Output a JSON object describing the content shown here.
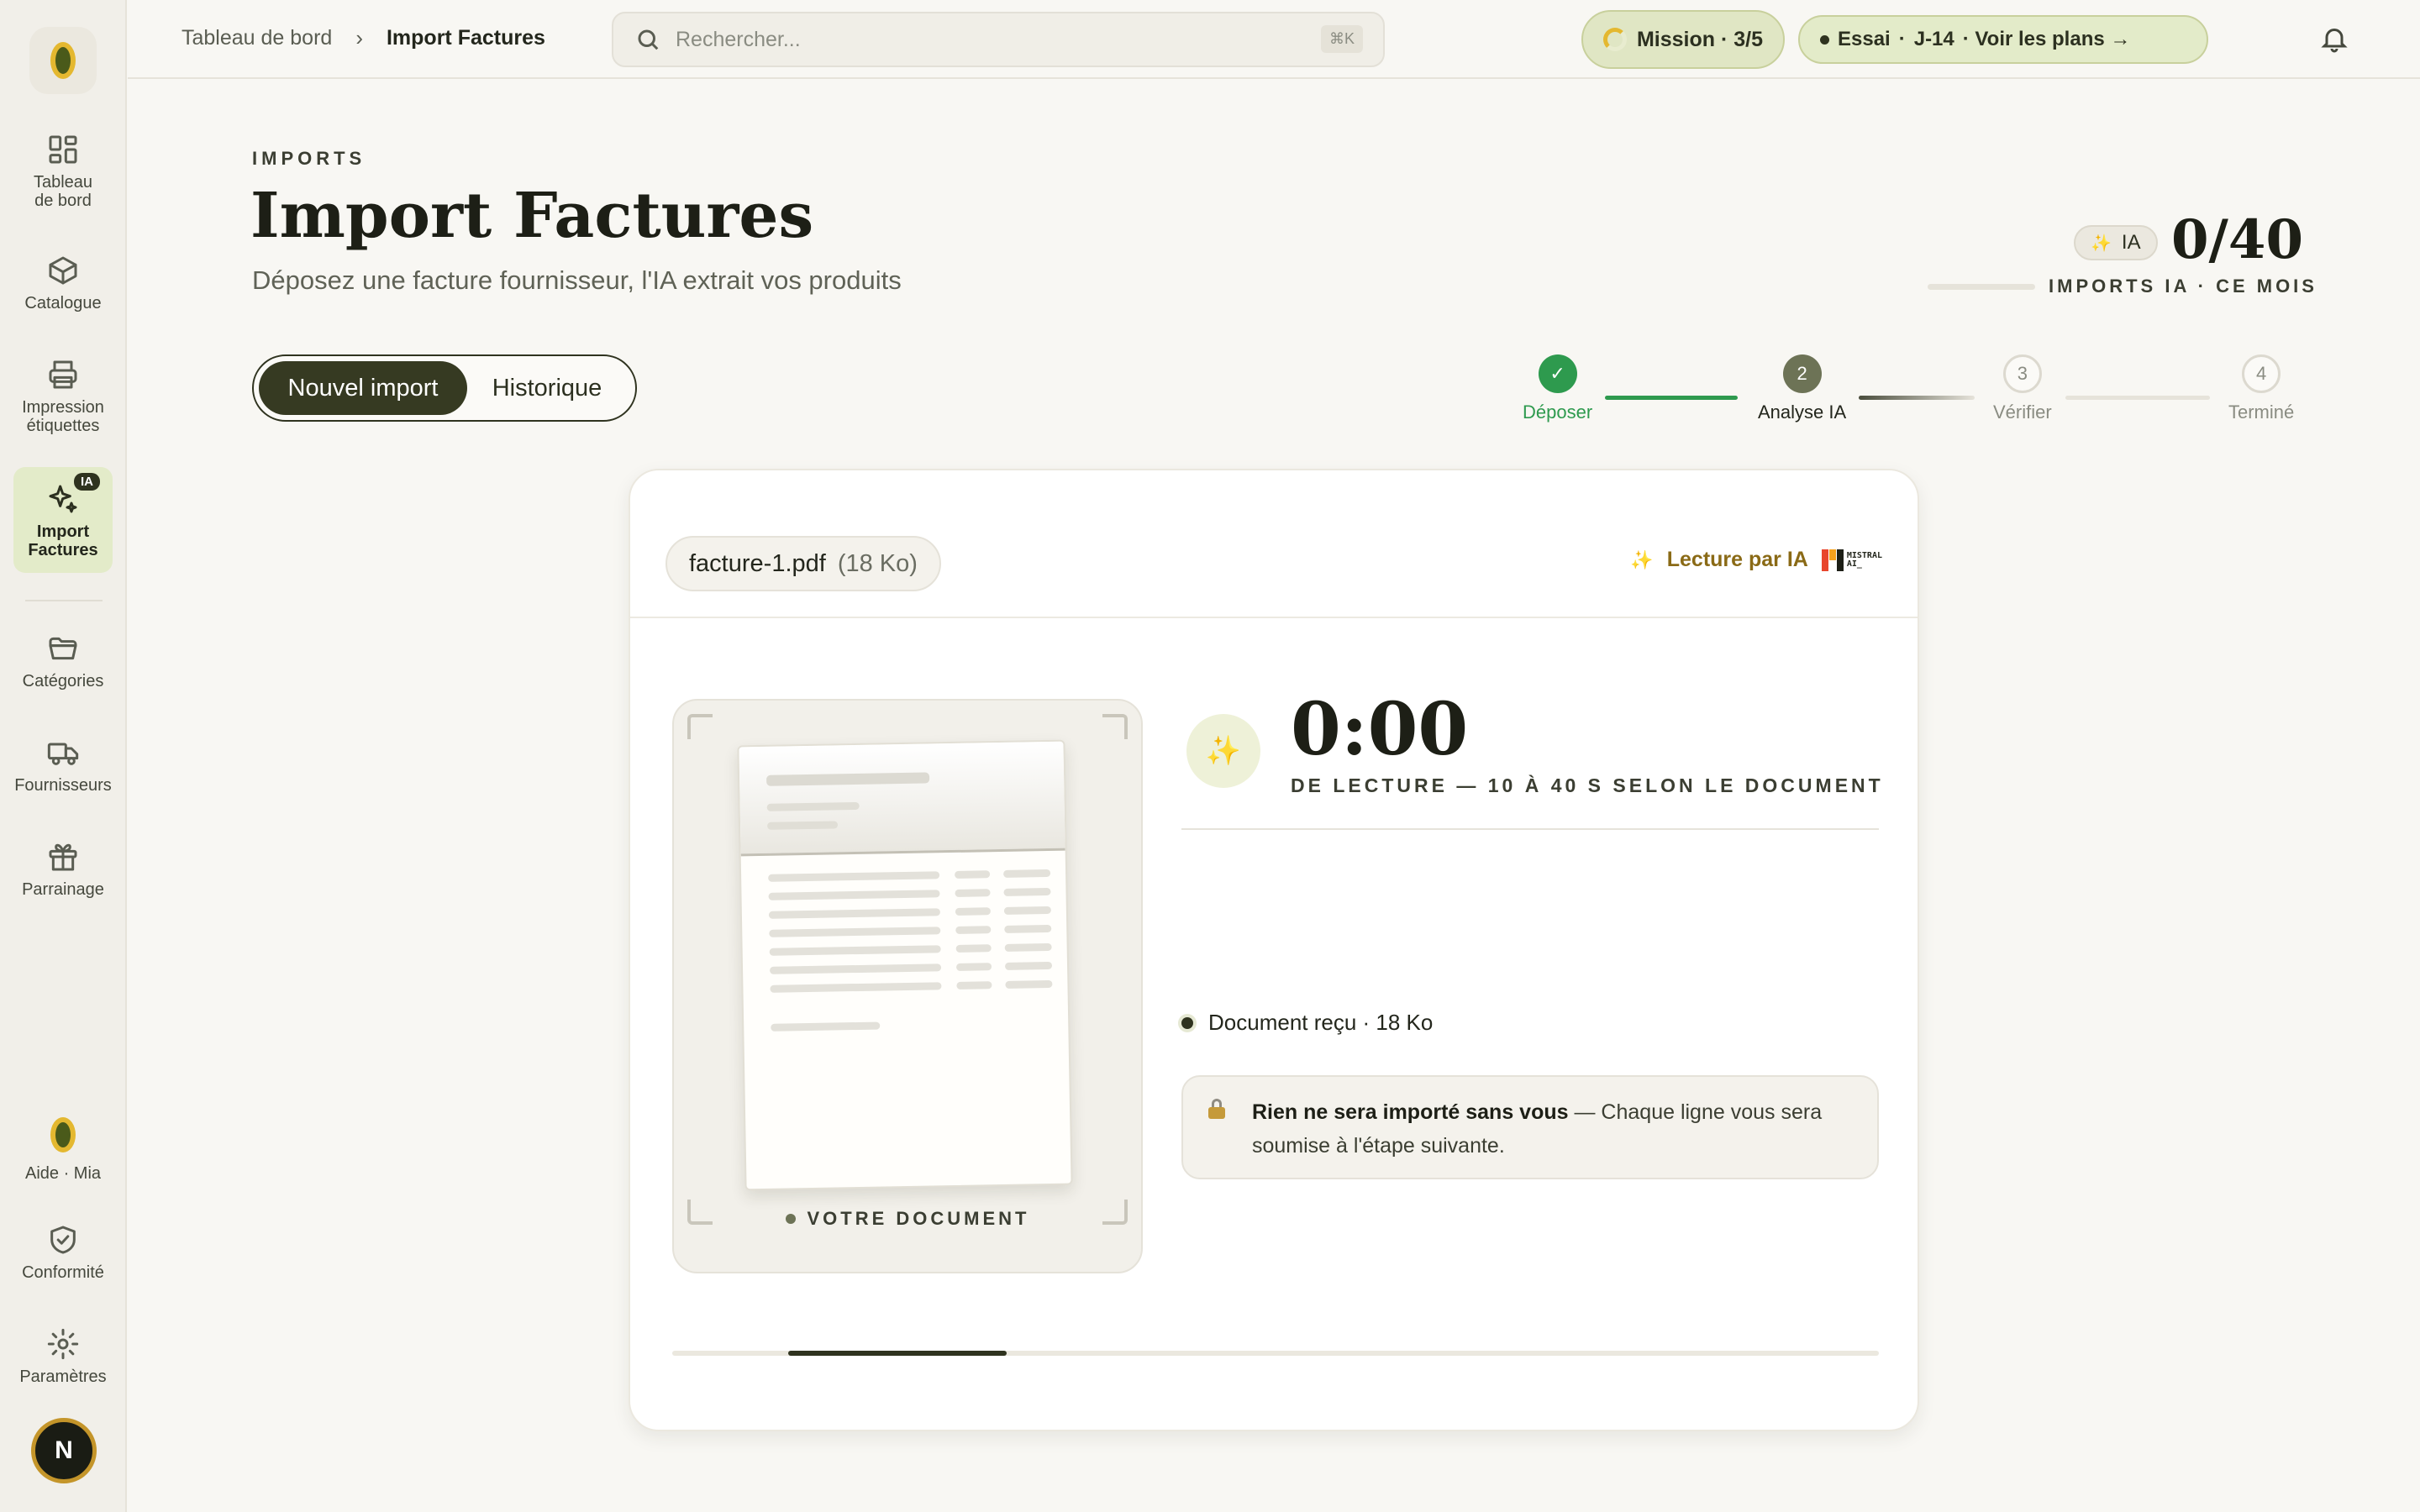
{
  "sidebar": {
    "items": [
      {
        "label": "Tableau de bord",
        "icon": "dashboard-icon"
      },
      {
        "label": "Catalogue",
        "icon": "box-icon"
      },
      {
        "label": "Impression étiquettes",
        "icon": "printer-icon"
      },
      {
        "label": "Import Factures",
        "icon": "sparkles-icon",
        "badge": "IA",
        "active": true
      },
      {
        "label": "Catégories",
        "icon": "folder-icon"
      },
      {
        "label": "Fournisseurs",
        "icon": "truck-icon"
      },
      {
        "label": "Parrainage",
        "icon": "gift-icon"
      }
    ],
    "bottom_items": [
      {
        "label": "Aide · Mia",
        "icon": "olive-icon"
      },
      {
        "label": "Conformité",
        "icon": "shield-check-icon"
      },
      {
        "label": "Paramètres",
        "icon": "gear-icon"
      }
    ],
    "avatar_initial": "N"
  },
  "topbar": {
    "breadcrumb": [
      "Tableau de bord",
      "Import Factures"
    ],
    "search_placeholder": "Rechercher...",
    "search_shortcut": "⌘K",
    "mission_label": "Mission · 3/5",
    "mission_progress": 0.6,
    "trial_label": "Essai",
    "trial_days": "J-14",
    "trial_cta": "· Voir les plans →"
  },
  "header": {
    "eyebrow": "IMPORTS",
    "title": "Import Factures",
    "subtitle": "Déposez une facture fournisseur, l'IA extrait vos produits",
    "quota_badge": "IA",
    "quota_value": "0/40",
    "quota_label": "IMPORTS IA · CE MOIS",
    "quota_used": 0
  },
  "tabs": {
    "new_import": "Nouvel import",
    "history": "Historique"
  },
  "stepper": [
    {
      "number": "✓",
      "label": "Déposer",
      "state": "done"
    },
    {
      "number": "2",
      "label": "Analyse IA",
      "state": "current"
    },
    {
      "number": "3",
      "label": "Vérifier",
      "state": "todo"
    },
    {
      "number": "4",
      "label": "Terminé",
      "state": "todo"
    }
  ],
  "card": {
    "file_name": "facture-1.pdf",
    "file_size": "(18 Ko)",
    "ai_read_label": "Lecture par IA",
    "mistral_text_1": "MISTRAL",
    "mistral_text_2": "AI_",
    "doc_label": "VOTRE DOCUMENT",
    "timer": "0:00",
    "timer_caption": "DE LECTURE — 10 À 40 S SELON LE DOCUMENT",
    "status": "Document reçu · 18 Ko",
    "notice_strong": "Rien ne sera importé sans vous",
    "notice_text": " — Chaque ligne vous sera soumise à l'étape suivante.",
    "progress_start": 0.096,
    "progress_end": 0.277
  },
  "colors": {
    "accent_dark": "#2f331f",
    "accent_yellow": "#e4b830",
    "success": "#2e9a4e",
    "highlight": "#e3ebc9"
  }
}
